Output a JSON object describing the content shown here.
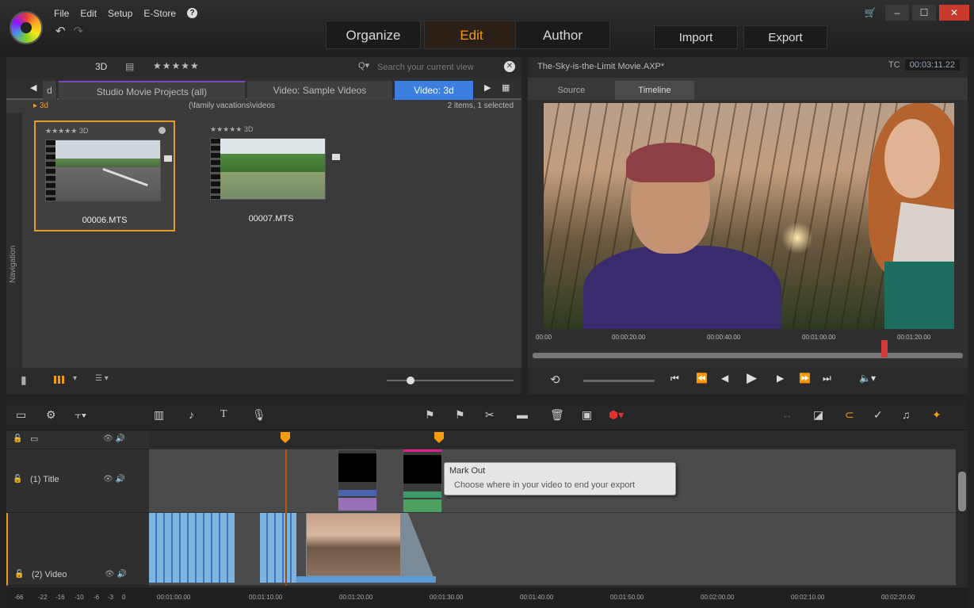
{
  "menu": {
    "file": "File",
    "edit": "Edit",
    "setup": "Setup",
    "estore": "E-Store",
    "help": "?"
  },
  "modes": {
    "organize": "Organize",
    "edit": "Edit",
    "author": "Author"
  },
  "actions": {
    "import": "Import",
    "export": "Export"
  },
  "window": {
    "minimize": "–",
    "maximize": "☐",
    "close": "✕"
  },
  "library": {
    "tag": "3D",
    "stars": "★★★★★",
    "search_placeholder": "Search your current view",
    "tabs": [
      {
        "label": "d"
      },
      {
        "label": "Studio Movie Projects (all)"
      },
      {
        "label": "Video: Sample Videos"
      },
      {
        "label": "Video: 3d"
      }
    ],
    "folder": "3d",
    "path": "(\\family vacations\\videos",
    "count": "2 items, 1 selected",
    "navigation_label": "Navigation",
    "clips": [
      {
        "name": "00006.MTS",
        "stars": "★★★★★ 3D",
        "selected": true
      },
      {
        "name": "00007.MTS",
        "stars": "★★★★★ 3D",
        "selected": false
      }
    ]
  },
  "player": {
    "title": "The-Sky-is-the-Limit Movie.AXP*",
    "tc_label": "TC",
    "timecode": "00:03:11.22",
    "tabs": {
      "source": "Source",
      "timeline": "Timeline"
    },
    "ruler": [
      "00:00",
      "00:00:20.00",
      "00:00:40.00",
      "00:01:00.00",
      "00:01:20.00"
    ],
    "scrub_position_percent": 81
  },
  "timeline": {
    "tracks": [
      {
        "name": "(1) Title"
      },
      {
        "name": "(2) Video"
      }
    ],
    "tooltip": {
      "title": "Mark Out",
      "text": "Choose where in your video to end your export"
    },
    "ruler": [
      "00:01:00.00",
      "00:01:10.00",
      "00:01:20.00",
      "00:01:30.00",
      "00:01:40.00",
      "00:01:50.00",
      "00:02:00.00",
      "00:02:10.00",
      "00:02:20.00"
    ],
    "db_scale": [
      "-66",
      "-22",
      "-16",
      "-10",
      "-6",
      "-3",
      "0"
    ]
  },
  "colors": {
    "accent": "#f39c12",
    "active_tab": "#3d7fe0",
    "close": "#c93a2c"
  }
}
